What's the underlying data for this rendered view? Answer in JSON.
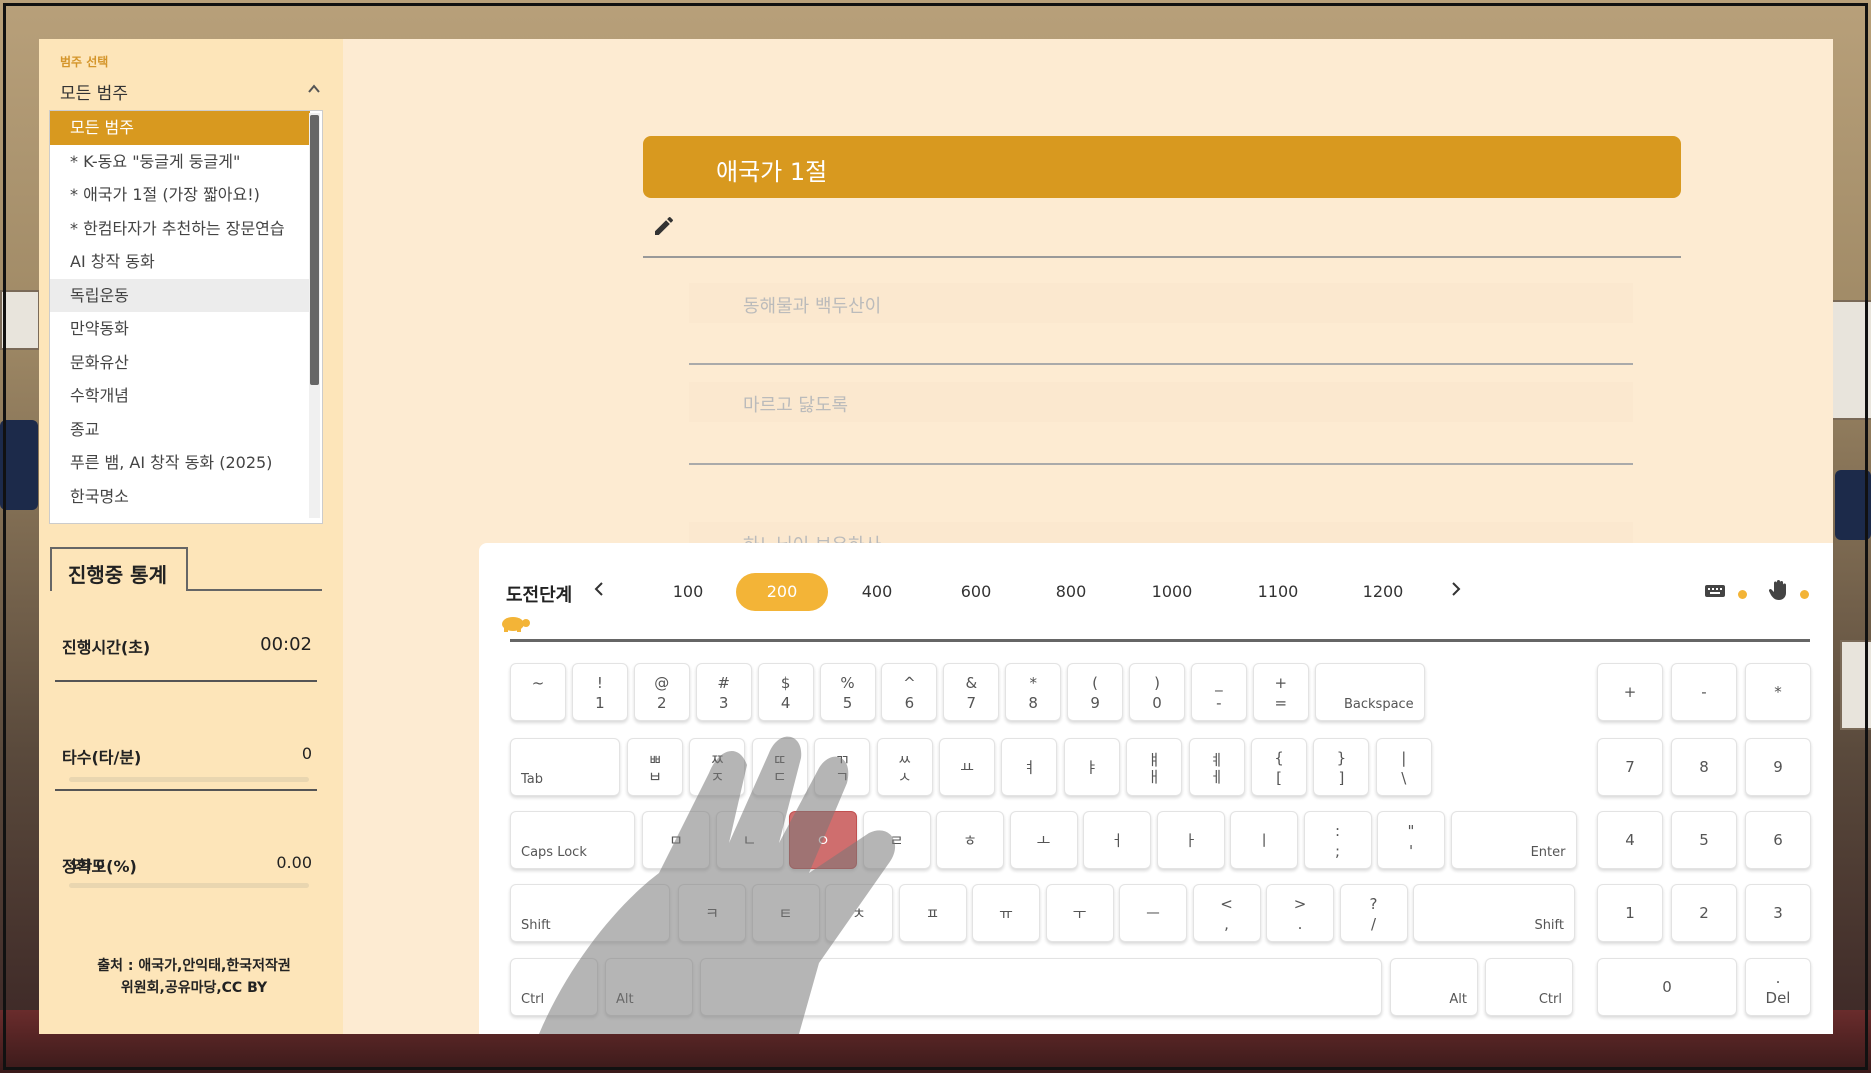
{
  "sidebar": {
    "category_label": "범주 선택",
    "selected_category": "모든 범주",
    "categories": [
      "모든 범주",
      "* K-동요 \"둥글게 둥글게\"",
      "* 애국가 1절 (가장 짧아요!)",
      "* 한컴타자가 추천하는 장문연습",
      "AI 창작 동화",
      "독립운동",
      "만약동화",
      "문화유산",
      "수학개념",
      "종교",
      "푸른 뱀, AI 창작 동화 (2025)",
      "한국명소"
    ],
    "stats_tab": "진행중 통계",
    "stats": {
      "time_label": "진행시간(초)",
      "time_value": "00:02",
      "speed_label": "타수(타/분)",
      "speed_value": "0",
      "speed_progress": 0,
      "accuracy_label": "정확도(%)",
      "accuracy_value": "0.00",
      "accuracy_progress": 0,
      "errors": "오타 0"
    },
    "source_line1": "출처 : 애국가,안익태,한국저작권",
    "source_line2": "위원회,공유마당,CC BY"
  },
  "practice": {
    "title": "애국가 1절",
    "input_value": "",
    "lines": [
      "동해물과 백두산이",
      "마르고 닳도록",
      "하느님이 보우하사"
    ]
  },
  "keyboard_panel": {
    "challenge_label": "도전단계",
    "prev_icon": "chevron-left-icon",
    "next_icon": "chevron-right-icon",
    "levels": [
      "100",
      "200",
      "400",
      "600",
      "800",
      "1000",
      "1100",
      "1200"
    ],
    "active_level": "200",
    "keyboard_icon": "keyboard-icon",
    "hand_icon": "hand-icon",
    "accent_color": "#f3b437",
    "highlight_color": "#cf6e6e",
    "highlighted_key": "ㅇ"
  },
  "keys": {
    "row1": [
      {
        "t": "~",
        "b": ""
      },
      {
        "t": "!",
        "b": "1"
      },
      {
        "t": "@",
        "b": "2"
      },
      {
        "t": "#",
        "b": "3"
      },
      {
        "t": "$",
        "b": "4"
      },
      {
        "t": "%",
        "b": "5"
      },
      {
        "t": "^",
        "b": "6"
      },
      {
        "t": "&",
        "b": "7"
      },
      {
        "t": "*",
        "b": "8"
      },
      {
        "t": "(",
        "b": "9"
      },
      {
        "t": ")",
        "b": "0"
      },
      {
        "t": "_",
        "b": "-"
      },
      {
        "t": "+",
        "b": "="
      }
    ],
    "backspace": "Backspace",
    "tab": "Tab",
    "row2": [
      {
        "t": "ㅃ",
        "b": "ㅂ"
      },
      {
        "t": "ㅉ",
        "b": "ㅈ"
      },
      {
        "t": "ㄸ",
        "b": "ㄷ"
      },
      {
        "t": "ㄲ",
        "b": "ㄱ"
      },
      {
        "t": "ㅆ",
        "b": "ㅅ"
      },
      {
        "t": "",
        "b": "",
        "c": "ㅛ"
      },
      {
        "t": "",
        "b": "",
        "c": "ㅕ"
      },
      {
        "t": "",
        "b": "",
        "c": "ㅑ"
      },
      {
        "t": "ㅒ",
        "b": "ㅐ"
      },
      {
        "t": "ㅖ",
        "b": "ㅔ"
      },
      {
        "t": "{",
        "b": "["
      },
      {
        "t": "}",
        "b": "]"
      },
      {
        "t": "|",
        "b": "\\"
      }
    ],
    "capslock": "Caps Lock",
    "row3": [
      "ㅁ",
      "ㄴ",
      "ㅇ",
      "ㄹ",
      "ㅎ",
      "ㅗ",
      "ㅓ",
      "ㅏ",
      "ㅣ"
    ],
    "row3_sym": [
      {
        "t": ":",
        "b": ";"
      },
      {
        "t": "\"",
        "b": "'"
      }
    ],
    "enter": "Enter",
    "shift_left": "Shift",
    "row4": [
      "ㅋ",
      "ㅌ",
      "ㅊ",
      "ㅍ",
      "ㅠ",
      "ㅜ",
      "ㅡ"
    ],
    "row4_sym": [
      {
        "t": "<",
        "b": ","
      },
      {
        "t": ">",
        "b": "."
      },
      {
        "t": "?",
        "b": "/"
      }
    ],
    "shift_right": "Shift",
    "ctrl_left": "Ctrl",
    "alt_left": "Alt",
    "alt_right": "Alt",
    "ctrl_right": "Ctrl",
    "numpad_top": [
      "+",
      "-",
      "*"
    ],
    "numpad_r1": [
      "7",
      "8",
      "9"
    ],
    "numpad_r2": [
      "4",
      "5",
      "6"
    ],
    "numpad_r3": [
      "1",
      "2",
      "3"
    ],
    "numpad_zero": "0",
    "numpad_del_top": ".",
    "numpad_del": "Del"
  }
}
